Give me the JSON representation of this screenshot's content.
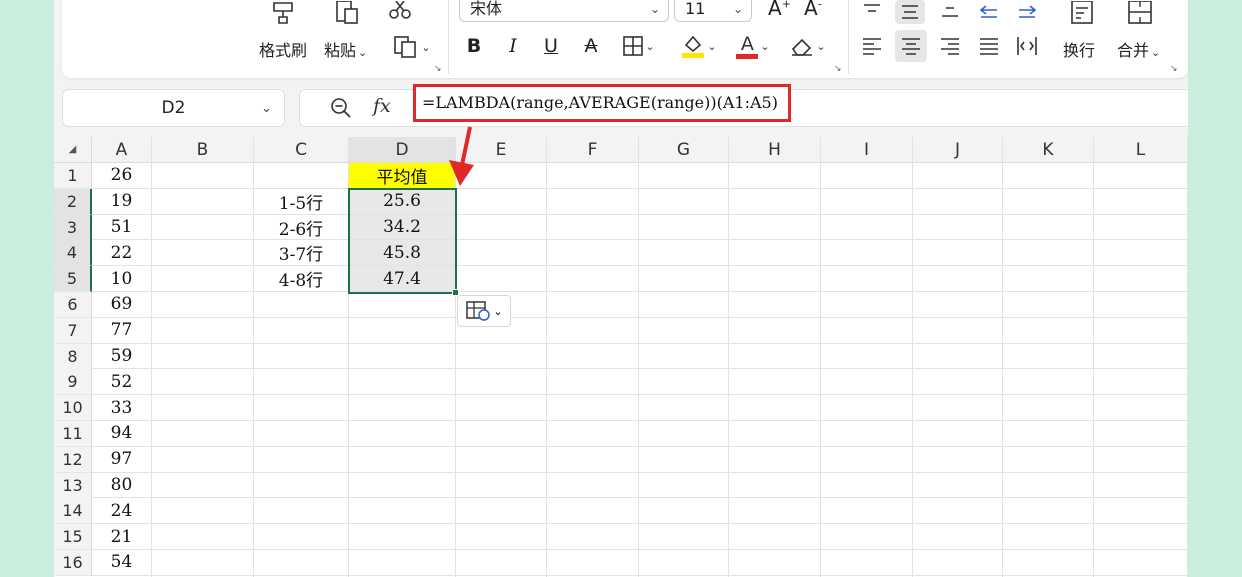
{
  "ribbon": {
    "format_painter_label": "格式刷",
    "paste_label": "粘贴",
    "font_name": "宋体",
    "font_size": "11",
    "grow_font": "A",
    "shrink_font": "A",
    "bold": "B",
    "italic": "I",
    "underline": "U",
    "strike": "A",
    "font_color_letter": "A",
    "wrap_label": "换行",
    "merge_label": "合并",
    "colors": {
      "highlight": "#ffe600",
      "font_color": "#e0272a"
    }
  },
  "formula_bar": {
    "cell_ref": "D2",
    "fx_label": "fx",
    "formula": "=LAMBDA(range,AVERAGE(range))(A1:A5)"
  },
  "sheet": {
    "columns": [
      "A",
      "B",
      "C",
      "D",
      "E",
      "F",
      "G",
      "H",
      "I",
      "J",
      "K",
      "L"
    ],
    "selected_column": "D",
    "rows": [
      "1",
      "2",
      "3",
      "4",
      "5",
      "6",
      "7",
      "8",
      "9",
      "10",
      "11",
      "12",
      "13",
      "14",
      "15",
      "16"
    ],
    "column_a": [
      "26",
      "19",
      "51",
      "22",
      "10",
      "69",
      "77",
      "59",
      "52",
      "33",
      "94",
      "97",
      "80",
      "24",
      "21",
      "54"
    ],
    "column_c": [
      "",
      "1-5行",
      "2-6行",
      "3-7行",
      "4-8行"
    ],
    "column_d": [
      "平均值",
      "25.6",
      "34.2",
      "45.8",
      "47.4"
    ],
    "accent": "#1e7145",
    "header_fill": "#ffff00",
    "annotation_color": "#e0272a"
  }
}
